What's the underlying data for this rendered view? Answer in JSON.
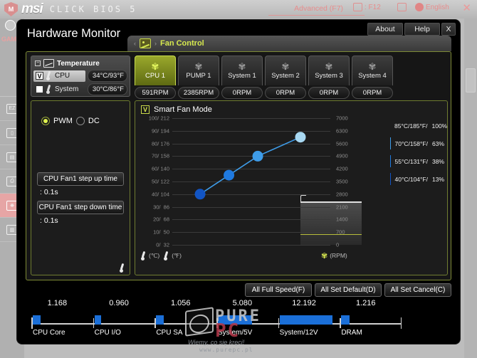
{
  "bios": {
    "brand": "msi",
    "brand_suffix": "CLICK BIOS 5",
    "mode_label": "Advanced (F7)",
    "screenshot_key": ": F12",
    "language": "English",
    "close_label": "✕",
    "gaming_label": "GAMI",
    "rail_items": [
      {
        "name": "ez-mode",
        "glyph": "EZ"
      },
      {
        "name": "favorites",
        "glyph": "▯"
      },
      {
        "name": "overclock",
        "glyph": "▤"
      },
      {
        "name": "m-flash",
        "glyph": "⎙"
      },
      {
        "name": "hardware-monitor",
        "glyph": "❋"
      },
      {
        "name": "boot",
        "glyph": "▥"
      }
    ]
  },
  "dialog": {
    "title": "Hardware Monitor",
    "window_buttons": [
      {
        "name": "about",
        "label": "About"
      },
      {
        "name": "help",
        "label": "Help"
      },
      {
        "name": "close",
        "label": "X"
      }
    ],
    "breadcrumb": {
      "back_arrow": "‹",
      "forward_arrow": "›",
      "label": "Fan Control"
    }
  },
  "temperature": {
    "header": "Temperature",
    "rows": [
      {
        "name": "cpu",
        "label": "CPU",
        "value": "34°C/93°F",
        "checked": true,
        "check_glyph": "V"
      },
      {
        "name": "system",
        "label": "System",
        "value": "30°C/86°F",
        "checked": false,
        "check_glyph": ""
      }
    ]
  },
  "fan_tabs": [
    {
      "name": "cpu-1",
      "label": "CPU 1",
      "rpm": "591RPM",
      "active": true
    },
    {
      "name": "pump-1",
      "label": "PUMP 1",
      "rpm": "2385RPM",
      "active": false
    },
    {
      "name": "system-1",
      "label": "System 1",
      "rpm": "0RPM",
      "active": false
    },
    {
      "name": "system-2",
      "label": "System 2",
      "rpm": "0RPM",
      "active": false
    },
    {
      "name": "system-3",
      "label": "System 3",
      "rpm": "0RPM",
      "active": false
    },
    {
      "name": "system-4",
      "label": "System 4",
      "rpm": "0RPM",
      "active": false
    }
  ],
  "fan_control": {
    "mode_pwm": "PWM",
    "mode_dc": "DC",
    "selected_mode": "PWM",
    "step_up_button": "CPU Fan1 step up time",
    "step_up_value": ": 0.1s",
    "step_down_button": "CPU Fan1 step down time",
    "step_down_value": ": 0.1s",
    "smart_fan_mode": "Smart Fan Mode",
    "smart_fan_enabled": true,
    "smart_fan_check_glyph": "V"
  },
  "chart_data": {
    "type": "line",
    "title": "Smart Fan Mode",
    "xlabel": "",
    "ylabel": "Temperature (°C / °F)",
    "y2label": "Fan Speed (RPM)",
    "yticks_left": [
      "100/ 212",
      "90/ 194",
      "80/ 176",
      "70/ 158",
      "60/ 140",
      "50/ 122",
      "40/ 104",
      "30/  86",
      "20/  68",
      "10/  50",
      "0/  32"
    ],
    "yticks_right": [
      "7000",
      "6300",
      "5600",
      "4900",
      "4200",
      "3500",
      "2800",
      "2100",
      "1400",
      "700",
      "0"
    ],
    "ylim_left": [
      0,
      100
    ],
    "ylim_right": [
      0,
      7000
    ],
    "grid": true,
    "series": [
      {
        "name": "fan-curve",
        "points": [
          {
            "temp_c": 40,
            "temp_f": 104,
            "duty_pct": 13,
            "color": "#1255c4"
          },
          {
            "temp_c": 55,
            "temp_f": 131,
            "duty_pct": 38,
            "color": "#1f7ae0"
          },
          {
            "temp_c": 70,
            "temp_f": 158,
            "duty_pct": 63,
            "color": "#3e9ce8"
          },
          {
            "temp_c": 85,
            "temp_f": 185,
            "duty_pct": 100,
            "color": "#a8d8f2"
          }
        ]
      }
    ],
    "history": {
      "pump_rpm_line": 2385,
      "cpu_fan_rpm_line": 591
    },
    "legend_position": "right",
    "legend": [
      {
        "swatch": "#a8d8f2",
        "temp": "85°C/185°F/",
        "pct": "100%"
      },
      {
        "swatch": "#3e9ce8",
        "temp": "70°C/158°F/",
        "pct": "63%"
      },
      {
        "swatch": "#1f7ae0",
        "temp": "55°C/131°F/",
        "pct": "38%"
      },
      {
        "swatch": "#1255c4",
        "temp": "40°C/104°F/",
        "pct": "13%"
      }
    ],
    "footer_left_unit_c": "(℃)",
    "footer_left_unit_f": "(℉)",
    "footer_right_unit": "(RPM)"
  },
  "actions": [
    {
      "name": "all-full-speed",
      "label": "All Full Speed(F)"
    },
    {
      "name": "all-set-default",
      "label": "All Set Default(D)"
    },
    {
      "name": "all-set-cancel",
      "label": "All Set Cancel(C)"
    }
  ],
  "voltages": [
    {
      "name": "cpu-core",
      "label": "CPU Core",
      "value": "1.168",
      "bar_pct": 14
    },
    {
      "name": "cpu-io",
      "label": "CPU I/O",
      "value": "0.960",
      "bar_pct": 12
    },
    {
      "name": "cpu-sa",
      "label": "CPU SA",
      "value": "1.056",
      "bar_pct": 13
    },
    {
      "name": "system-5v",
      "label": "System/5V",
      "value": "5.080",
      "bar_pct": 60
    },
    {
      "name": "system-12v",
      "label": "System/12V",
      "value": "12.192",
      "bar_pct": 92
    },
    {
      "name": "dram",
      "label": "DRAM",
      "value": "1.216",
      "bar_pct": 15
    }
  ],
  "watermark": {
    "brand_light": "PURE",
    "brand_accent": "PC",
    "tagline": "Wiemy, co się kręci!",
    "url": "www.purepc.pl"
  }
}
